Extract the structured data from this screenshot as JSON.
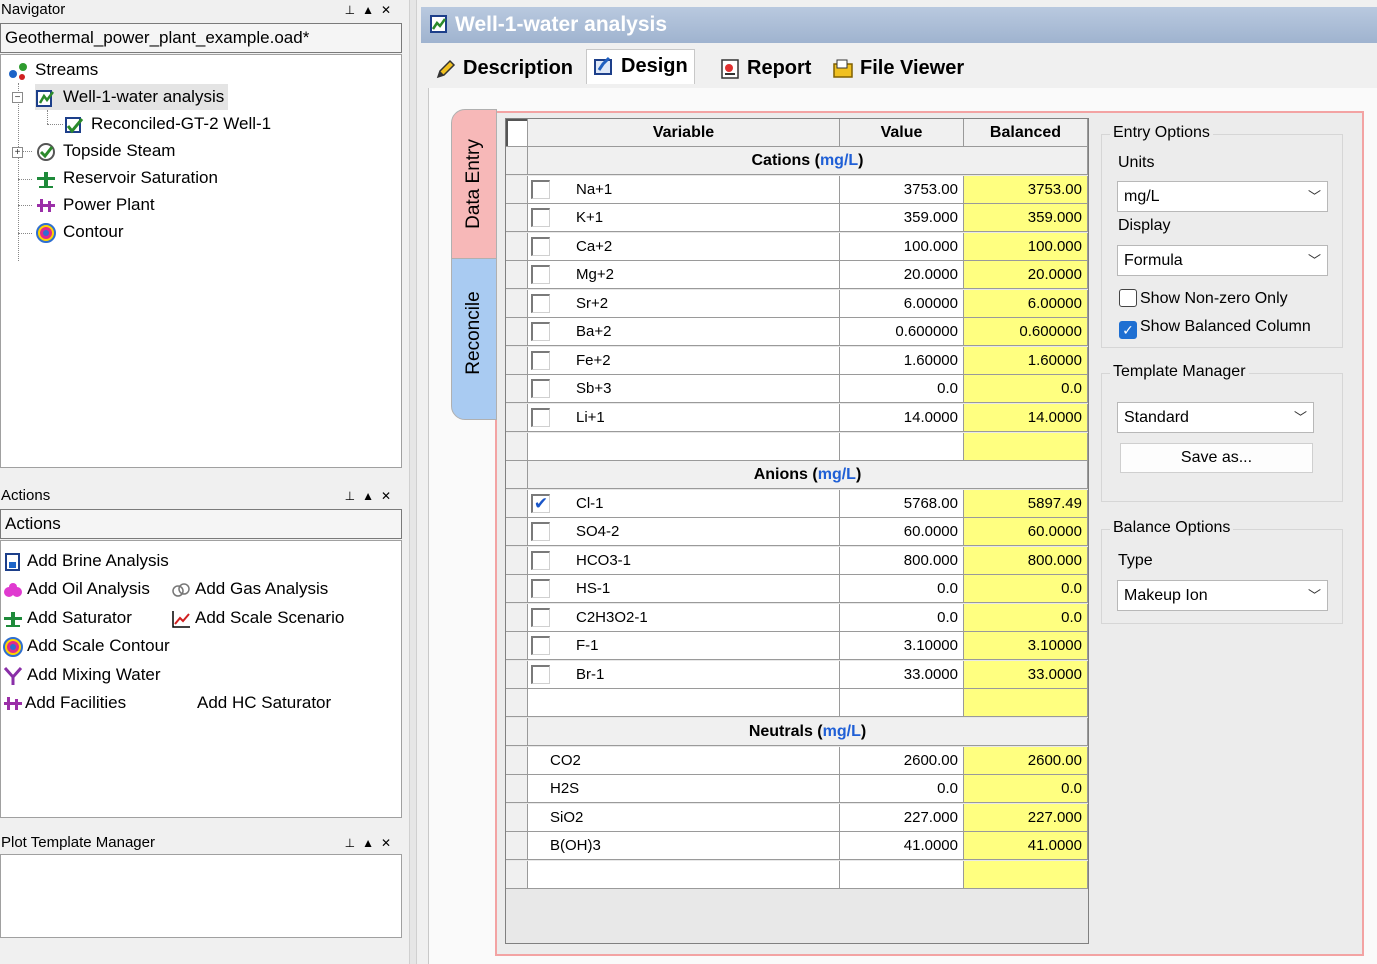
{
  "navigator": {
    "title": "Navigator",
    "file": "Geothermal_power_plant_example.oad*",
    "tree": [
      {
        "label": "Streams"
      },
      {
        "label": "Well-1-water analysis"
      },
      {
        "label": "Reconciled-GT-2 Well-1"
      },
      {
        "label": "Topside Steam"
      },
      {
        "label": "Reservoir Saturation"
      },
      {
        "label": "Power Plant"
      },
      {
        "label": "Contour"
      }
    ]
  },
  "actions": {
    "title": "Actions",
    "combo": "Actions",
    "items": [
      {
        "label": "Add Brine Analysis",
        "icon": "brine-icon"
      },
      {
        "label": "Add Oil Analysis",
        "icon": "oil-icon"
      },
      {
        "label": "Add Gas Analysis",
        "icon": "gas-icon"
      },
      {
        "label": "Add Saturator",
        "icon": "saturator-icon"
      },
      {
        "label": "Add Scale Scenario",
        "icon": "chart-icon"
      },
      {
        "label": "Add Scale Contour",
        "icon": "contour-icon"
      },
      {
        "label": "Add Mixing Water",
        "icon": "mixing-icon"
      },
      {
        "label": "Add Facilities",
        "icon": "facilities-icon"
      },
      {
        "label": "Add HC Saturator"
      }
    ]
  },
  "plot_template": {
    "title": "Plot Template Manager"
  },
  "document": {
    "title": "Well-1-water analysis",
    "tabs": [
      {
        "label": "Description"
      },
      {
        "label": "Design"
      },
      {
        "label": "Report"
      },
      {
        "label": "File Viewer"
      }
    ],
    "side_tabs": [
      {
        "label": "Data Entry"
      },
      {
        "label": "Reconcile"
      }
    ]
  },
  "grid": {
    "headers": [
      "Variable",
      "Value",
      "Balanced"
    ],
    "unit": "mg/L",
    "sections": [
      {
        "name": "Cations",
        "rows": [
          {
            "variable": "Na+1",
            "value": "3753.00",
            "balanced": "3753.00",
            "checked": false
          },
          {
            "variable": "K+1",
            "value": "359.000",
            "balanced": "359.000",
            "checked": false
          },
          {
            "variable": "Ca+2",
            "value": "100.000",
            "balanced": "100.000",
            "checked": false
          },
          {
            "variable": "Mg+2",
            "value": "20.0000",
            "balanced": "20.0000",
            "checked": false
          },
          {
            "variable": "Sr+2",
            "value": "6.00000",
            "balanced": "6.00000",
            "checked": false
          },
          {
            "variable": "Ba+2",
            "value": "0.600000",
            "balanced": "0.600000",
            "checked": false
          },
          {
            "variable": "Fe+2",
            "value": "1.60000",
            "balanced": "1.60000",
            "checked": false
          },
          {
            "variable": "Sb+3",
            "value": "0.0",
            "balanced": "0.0",
            "checked": false
          },
          {
            "variable": "Li+1",
            "value": "14.0000",
            "balanced": "14.0000",
            "checked": false
          }
        ]
      },
      {
        "name": "Anions",
        "rows": [
          {
            "variable": "Cl-1",
            "value": "5768.00",
            "balanced": "5897.49",
            "checked": true
          },
          {
            "variable": "SO4-2",
            "value": "60.0000",
            "balanced": "60.0000",
            "checked": false
          },
          {
            "variable": "HCO3-1",
            "value": "800.000",
            "balanced": "800.000",
            "checked": false
          },
          {
            "variable": "HS-1",
            "value": "0.0",
            "balanced": "0.0",
            "checked": false
          },
          {
            "variable": "C2H3O2-1",
            "value": "0.0",
            "balanced": "0.0",
            "checked": false
          },
          {
            "variable": "F-1",
            "value": "3.10000",
            "balanced": "3.10000",
            "checked": false
          },
          {
            "variable": "Br-1",
            "value": "33.0000",
            "balanced": "33.0000",
            "checked": false
          }
        ]
      },
      {
        "name": "Neutrals",
        "rows": [
          {
            "variable": "CO2",
            "value": "2600.00",
            "balanced": "2600.00"
          },
          {
            "variable": "H2S",
            "value": "0.0",
            "balanced": "0.0"
          },
          {
            "variable": "SiO2",
            "value": "227.000",
            "balanced": "227.000"
          },
          {
            "variable": "B(OH)3",
            "value": "41.0000",
            "balanced": "41.0000"
          }
        ]
      }
    ]
  },
  "entry_options": {
    "title": "Entry Options",
    "units_label": "Units",
    "units_value": "mg/L",
    "display_label": "Display",
    "display_value": "Formula",
    "show_nonzero_label": "Show Non-zero Only",
    "show_nonzero_checked": false,
    "show_balanced_label": "Show Balanced Column",
    "show_balanced_checked": true
  },
  "template_manager": {
    "title": "Template Manager",
    "value": "Standard",
    "save_label": "Save as..."
  },
  "balance_options": {
    "title": "Balance Options",
    "type_label": "Type",
    "type_value": "Makeup Ion"
  },
  "colors": {
    "accent": "#1e6fd2",
    "balanced_fill": "#ffff80",
    "frame": "#f3a3a3",
    "data_entry_tab": "#f7b8b8",
    "reconcile_tab": "#a9cbf2"
  }
}
